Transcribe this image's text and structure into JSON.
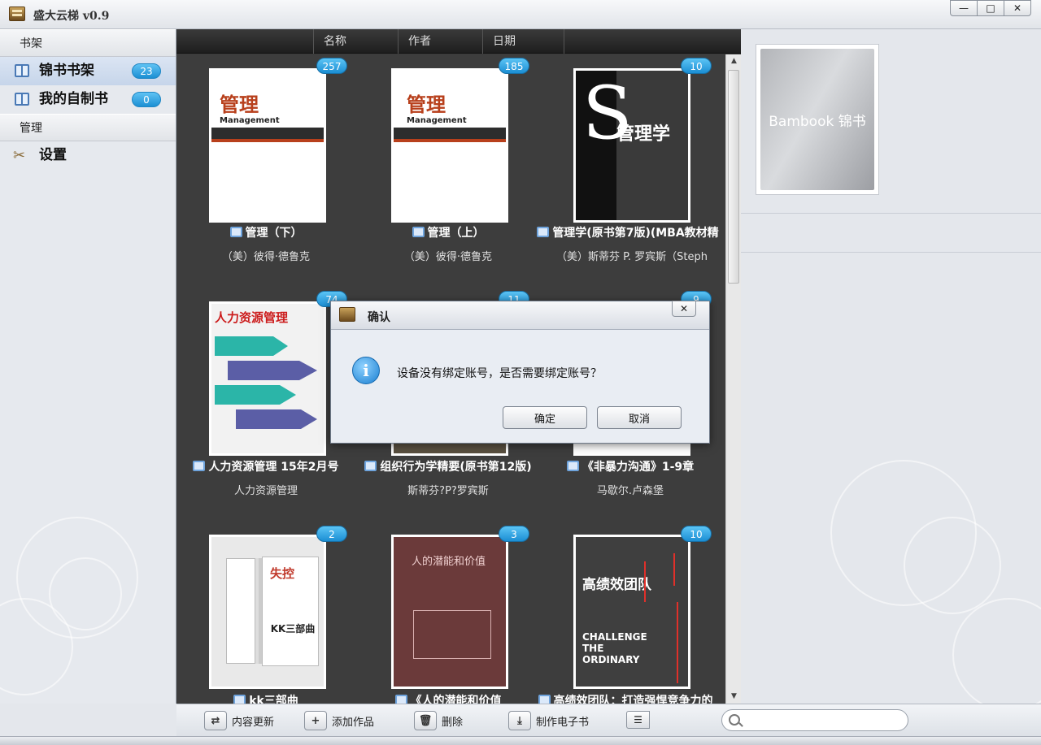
{
  "window": {
    "title": "盛大云梯 v0.9",
    "controls": [
      "—",
      "□",
      "✕"
    ]
  },
  "sidebar": {
    "section_shelf": "书架",
    "items": [
      {
        "label": "锦书书架",
        "badge": "23"
      },
      {
        "label": "我的自制书",
        "badge": "0"
      }
    ],
    "section_manage": "管理",
    "settings_label": "设置"
  },
  "columns": [
    "名称",
    "作者",
    "日期"
  ],
  "books": [
    {
      "count": "257",
      "title": "管理（下）",
      "author": "（美）彼得·德鲁克",
      "cover_title": "管理",
      "cover_sub": "Management",
      "cover_bg": "#ffffff",
      "cover_fg": "#b8401c"
    },
    {
      "count": "185",
      "title": "管理（上）",
      "author": "（美）彼得·德鲁克",
      "cover_title": "管理",
      "cover_sub": "Management",
      "cover_bg": "#ffffff",
      "cover_fg": "#b8401c"
    },
    {
      "count": "10",
      "title": "管理学(原书第7版)(MBA教材精",
      "author": "（美）斯蒂芬 P. 罗宾斯（Steph",
      "cover_title": "管理学",
      "cover_sub": "",
      "cover_bg": "#3a3a3a",
      "cover_fg": "#ffffff"
    },
    {
      "count": "74",
      "title": "人力资源管理 15年2月号",
      "author": "人力资源管理",
      "cover_title": "人力资源管理",
      "cover_sub": "",
      "cover_bg": "#f2f2f2",
      "cover_fg": "#cc1d1d"
    },
    {
      "count": "11",
      "title": "组织行为学精要(原书第12版)",
      "author": "斯蒂芬?P?罗宾斯",
      "cover_title": "",
      "cover_sub": "",
      "cover_bg": "#5a5040",
      "cover_fg": "#ffffff"
    },
    {
      "count": "9",
      "title": "《非暴力沟通》1-9章",
      "author": "马歇尔.卢森堡",
      "cover_title": "",
      "cover_sub": "",
      "cover_bg": "#ffffff",
      "cover_fg": "#333333"
    },
    {
      "count": "2",
      "title": "kk三部曲",
      "author": "",
      "cover_title": "失控",
      "cover_sub": "KK三部曲",
      "cover_bg": "#e9e9e9",
      "cover_fg": "#c0392b"
    },
    {
      "count": "3",
      "title": "《人的潜能和价值",
      "author": "",
      "cover_title": "人的潜能和价值",
      "cover_sub": "",
      "cover_bg": "#6b3a3a",
      "cover_fg": "#f0d0d0"
    },
    {
      "count": "10",
      "title": "高绩效团队：打造强悍竞争力的",
      "author": "",
      "cover_title": "高绩效团队",
      "cover_sub": "CHALLENGE THE ORDINARY",
      "cover_bg": "#3f3f3f",
      "cover_fg": "#ffffff"
    }
  ],
  "preview": {
    "logo": "Bambook 锦书"
  },
  "toolbar": {
    "refresh": "内容更新",
    "add": "添加作品",
    "delete": "删除",
    "make_ebook": "制作电子书",
    "search_placeholder": ""
  },
  "dialog": {
    "title": "确认",
    "message": "设备没有绑定账号，是否需要绑定账号？",
    "ok": "确定",
    "cancel": "取消",
    "close": "✕"
  },
  "colors": {
    "accent_badge": "#1c8fd3",
    "grid_bg": "#3d3d3d",
    "view_active": "#e98e07"
  }
}
